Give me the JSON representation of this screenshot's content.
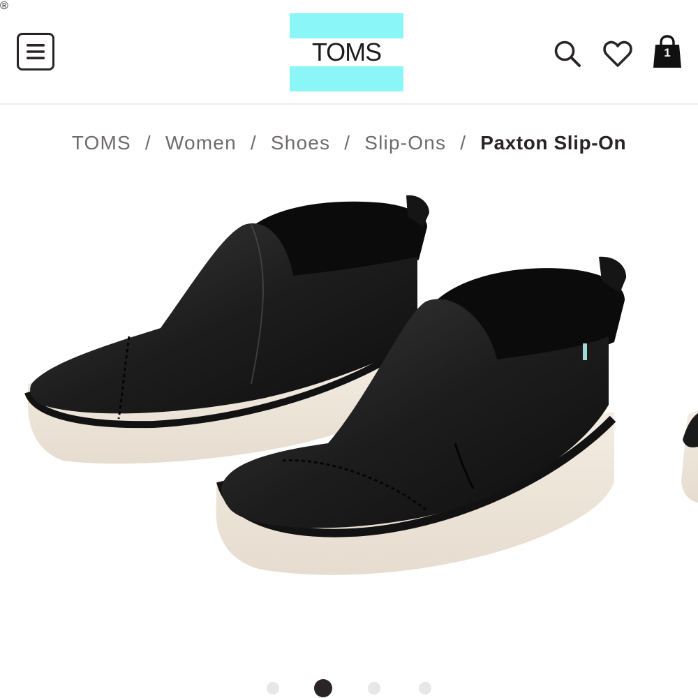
{
  "header": {
    "logo_text": "TOMS",
    "logo_registered_mark": "®",
    "logo_accent_color": "#8bf6f7",
    "menu_icon": "hamburger-menu-icon",
    "search_icon": "search-icon",
    "wishlist_icon": "heart-icon",
    "bag_icon": "shopping-bag-icon",
    "bag_count": "1"
  },
  "breadcrumb": {
    "items": [
      "TOMS",
      "Women",
      "Shoes",
      "Slip-Ons"
    ],
    "separator": "/",
    "current": "Paxton Slip-On"
  },
  "product": {
    "image_alt": "Paxton Slip-On"
  },
  "carousel": {
    "total_slides": 4,
    "active_index": 1
  }
}
